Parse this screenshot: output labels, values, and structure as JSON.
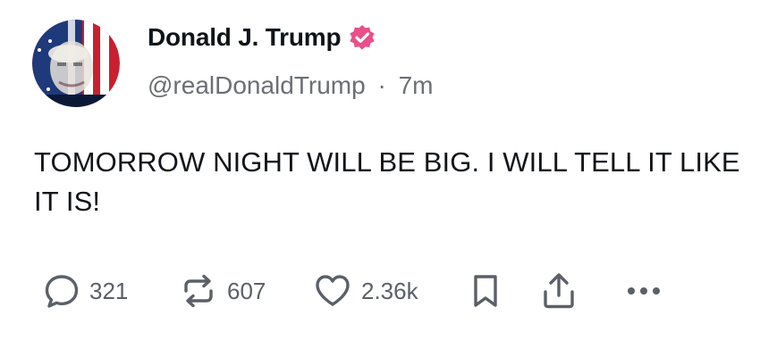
{
  "post": {
    "author": {
      "display_name": "Donald J. Trump",
      "handle": "@realDonaldTrump",
      "separator": "·",
      "time_ago": "7m",
      "verified_color": "#e94f8a"
    },
    "text": "TOMORROW NIGHT WILL BE BIG. I WILL TELL IT LIKE IT IS!",
    "actions": {
      "replies": "321",
      "reposts": "607",
      "likes": "2.36k"
    },
    "icons": [
      "reply-icon",
      "repost-icon",
      "like-icon",
      "bookmark-icon",
      "share-icon",
      "more-icon"
    ]
  }
}
